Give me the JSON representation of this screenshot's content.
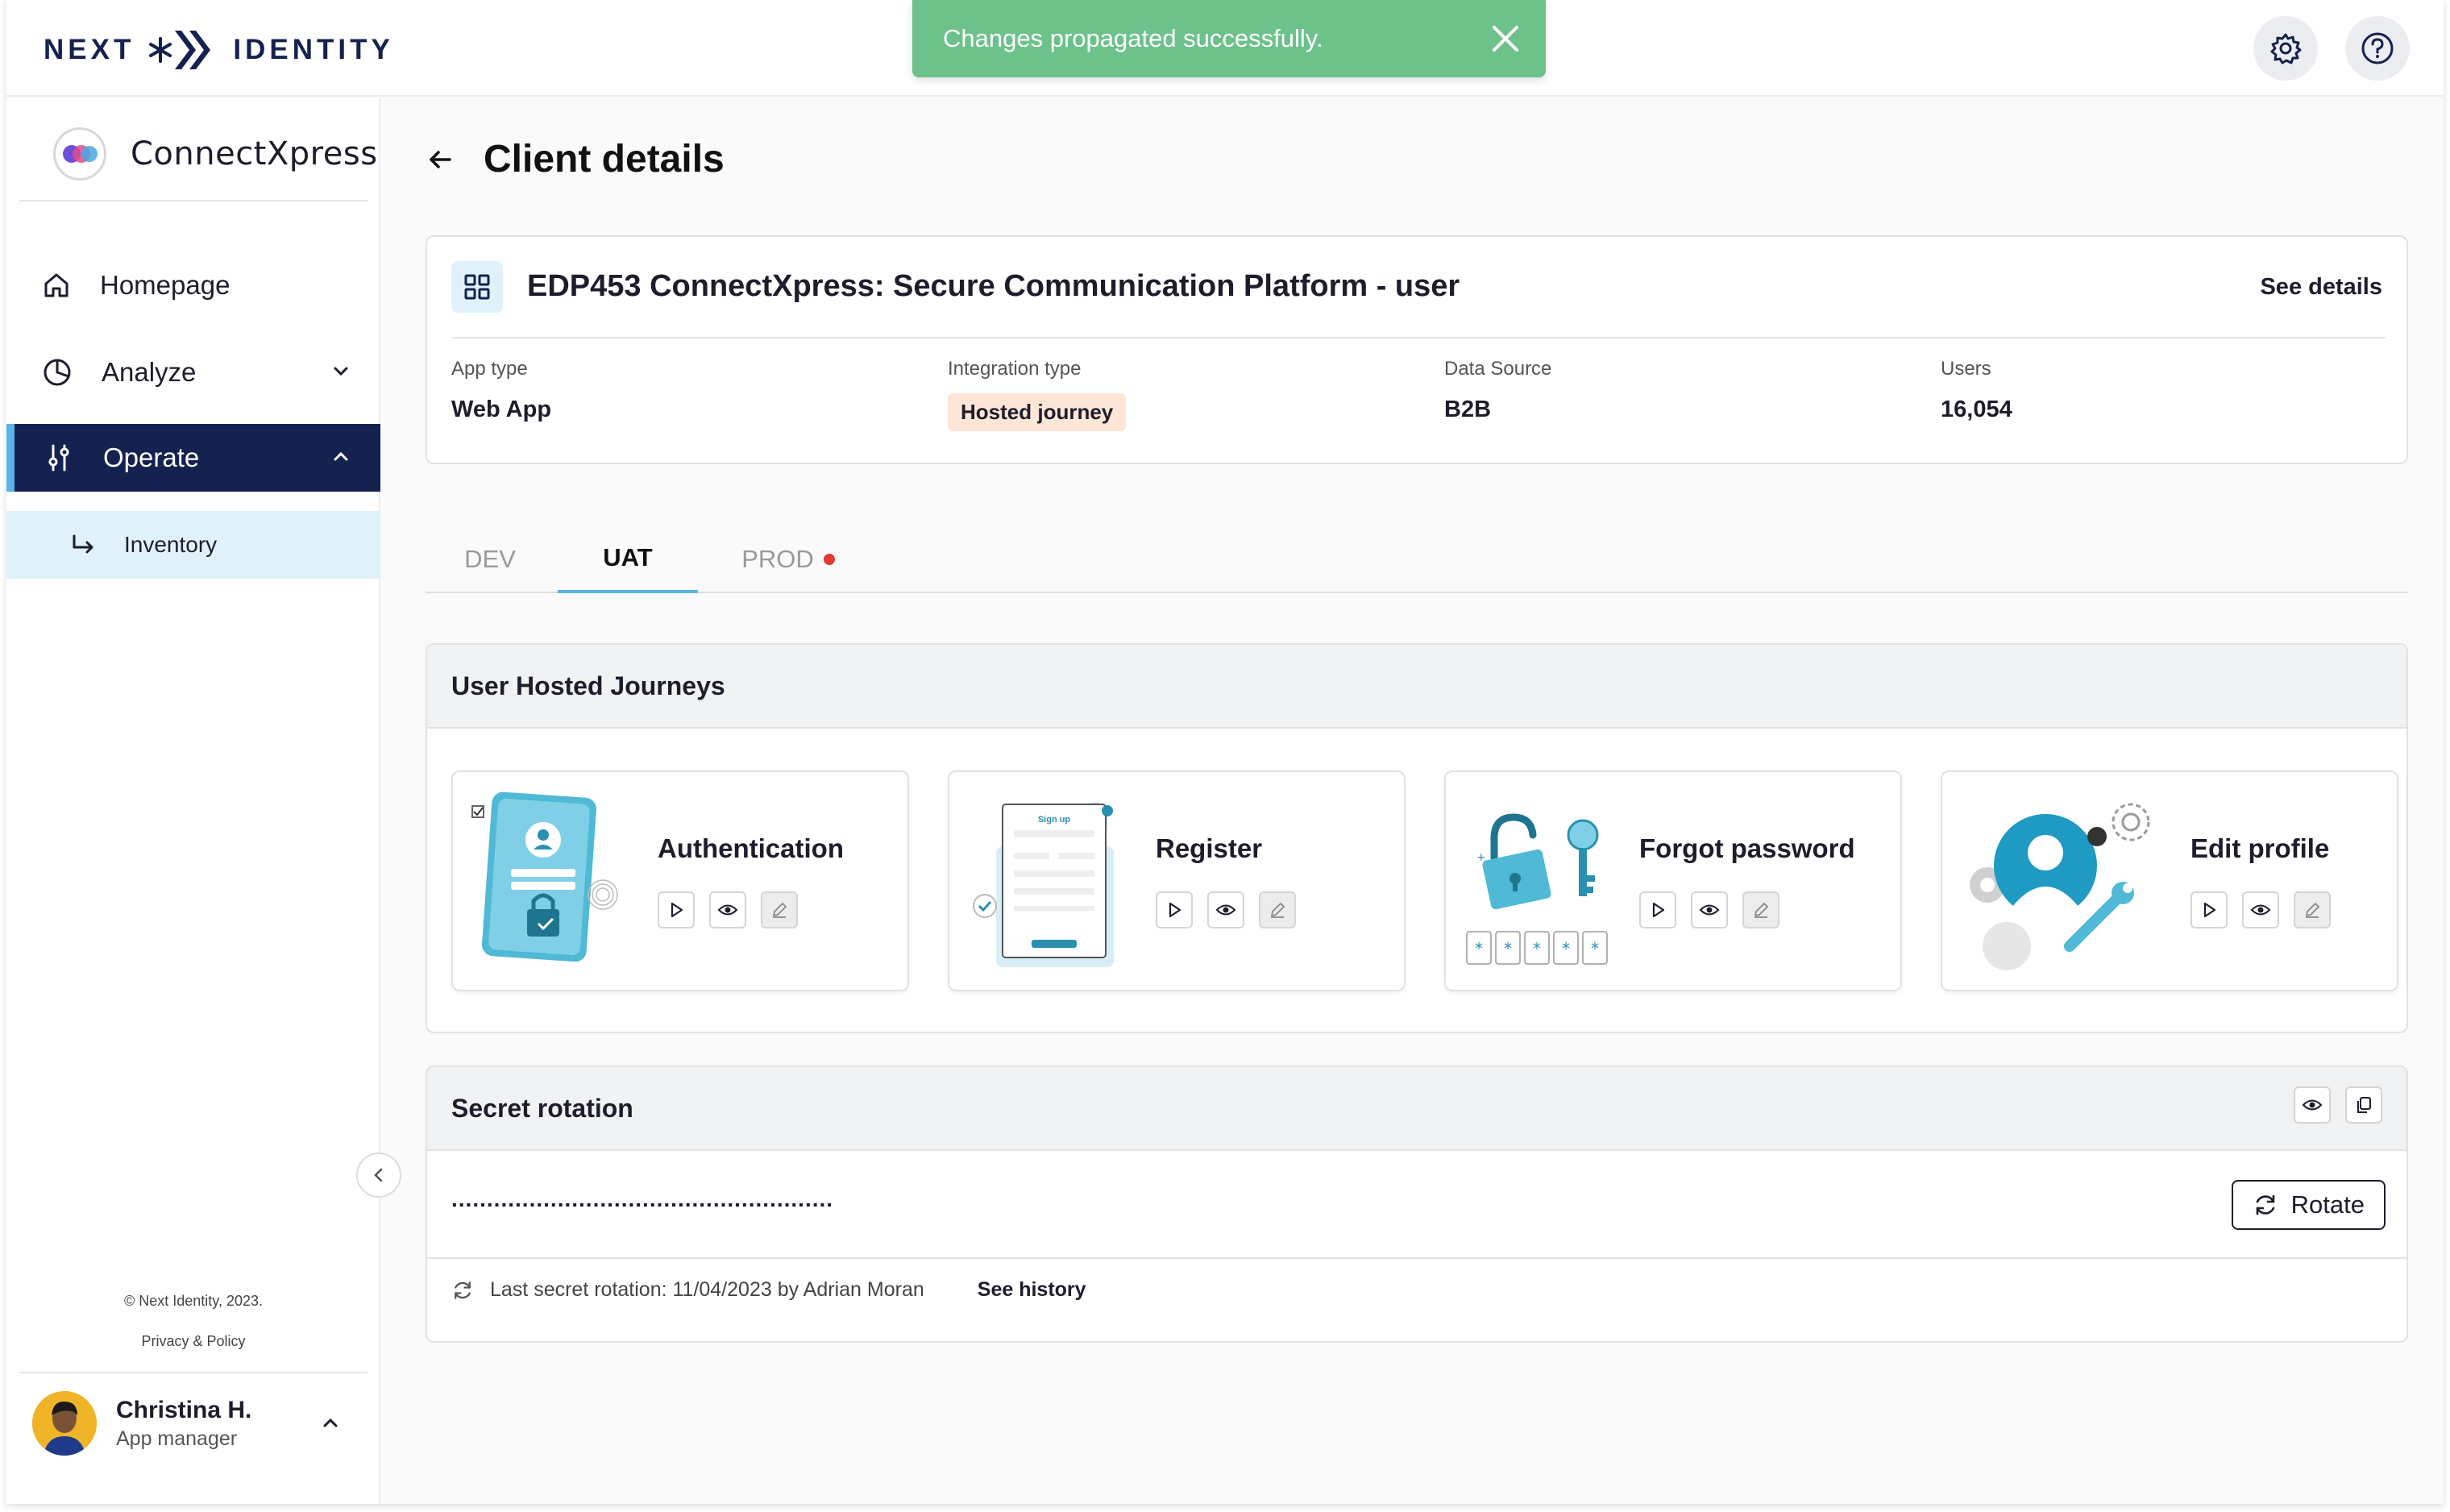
{
  "brand": {
    "left": "NEXT",
    "right": "IDENTITY"
  },
  "toast": {
    "message": "Changes propagated successfully."
  },
  "header": {
    "settings_icon": "gear-icon",
    "help_icon": "help-icon"
  },
  "sidebar": {
    "app_name": "ConnectXpress",
    "items": [
      {
        "label": "Homepage",
        "icon": "home-icon"
      },
      {
        "label": "Analyze",
        "icon": "pie-chart-icon"
      },
      {
        "label": "Operate",
        "icon": "sliders-icon"
      }
    ],
    "sub_item": {
      "label": "Inventory"
    },
    "copyright": "© Next Identity, 2023.",
    "privacy": "Privacy & Policy",
    "user": {
      "name": "Christina H.",
      "role": "App manager"
    }
  },
  "page": {
    "title": "Client details"
  },
  "client": {
    "name": "EDP453 ConnectXpress: Secure Communication Platform - user",
    "see_details": "See details",
    "meta": [
      {
        "label": "App type",
        "value": "Web App"
      },
      {
        "label": "Integration type",
        "value": "Hosted journey"
      },
      {
        "label": "Data Source",
        "value": "B2B"
      },
      {
        "label": "Users",
        "value": "16,054"
      }
    ]
  },
  "tabs": [
    {
      "label": "DEV"
    },
    {
      "label": "UAT"
    },
    {
      "label": "PROD"
    }
  ],
  "journeys": {
    "title": "User Hosted Journeys",
    "items": [
      {
        "title": "Authentication"
      },
      {
        "title": "Register"
      },
      {
        "title": "Forgot password"
      },
      {
        "title": "Edit profile"
      }
    ],
    "signup_text": "Sign up"
  },
  "secret": {
    "title": "Secret rotation",
    "masked_value": "......................................................",
    "rotate_label": "Rotate",
    "last_rotation": "Last secret rotation:  11/04/2023 by Adrian Moran",
    "see_history": "See history"
  }
}
